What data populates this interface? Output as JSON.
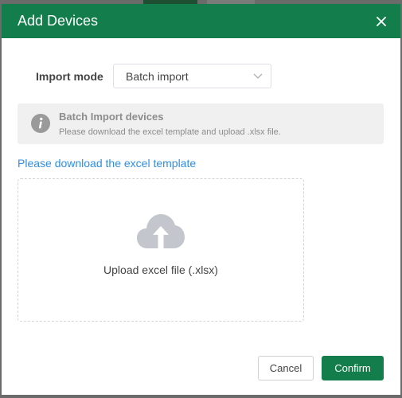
{
  "dialog": {
    "title": "Add Devices",
    "close_icon": "close-icon"
  },
  "import_mode": {
    "label": "Import mode",
    "selected": "Batch import",
    "chevron_icon": "chevron-down-icon"
  },
  "notice": {
    "icon": "info-icon",
    "title": "Batch Import devices",
    "description": "Please download the excel template and upload .xlsx file."
  },
  "download_link": "Please download the excel template",
  "upload": {
    "icon": "cloud-upload-icon",
    "label": "Upload excel file (.xlsx)"
  },
  "buttons": {
    "cancel": "Cancel",
    "confirm": "Confirm"
  },
  "colors": {
    "brand_green": "#137e4b",
    "link_blue": "#2f8ee6",
    "notice_bg": "#f0f0f0",
    "muted_text": "#8c8c8c"
  }
}
